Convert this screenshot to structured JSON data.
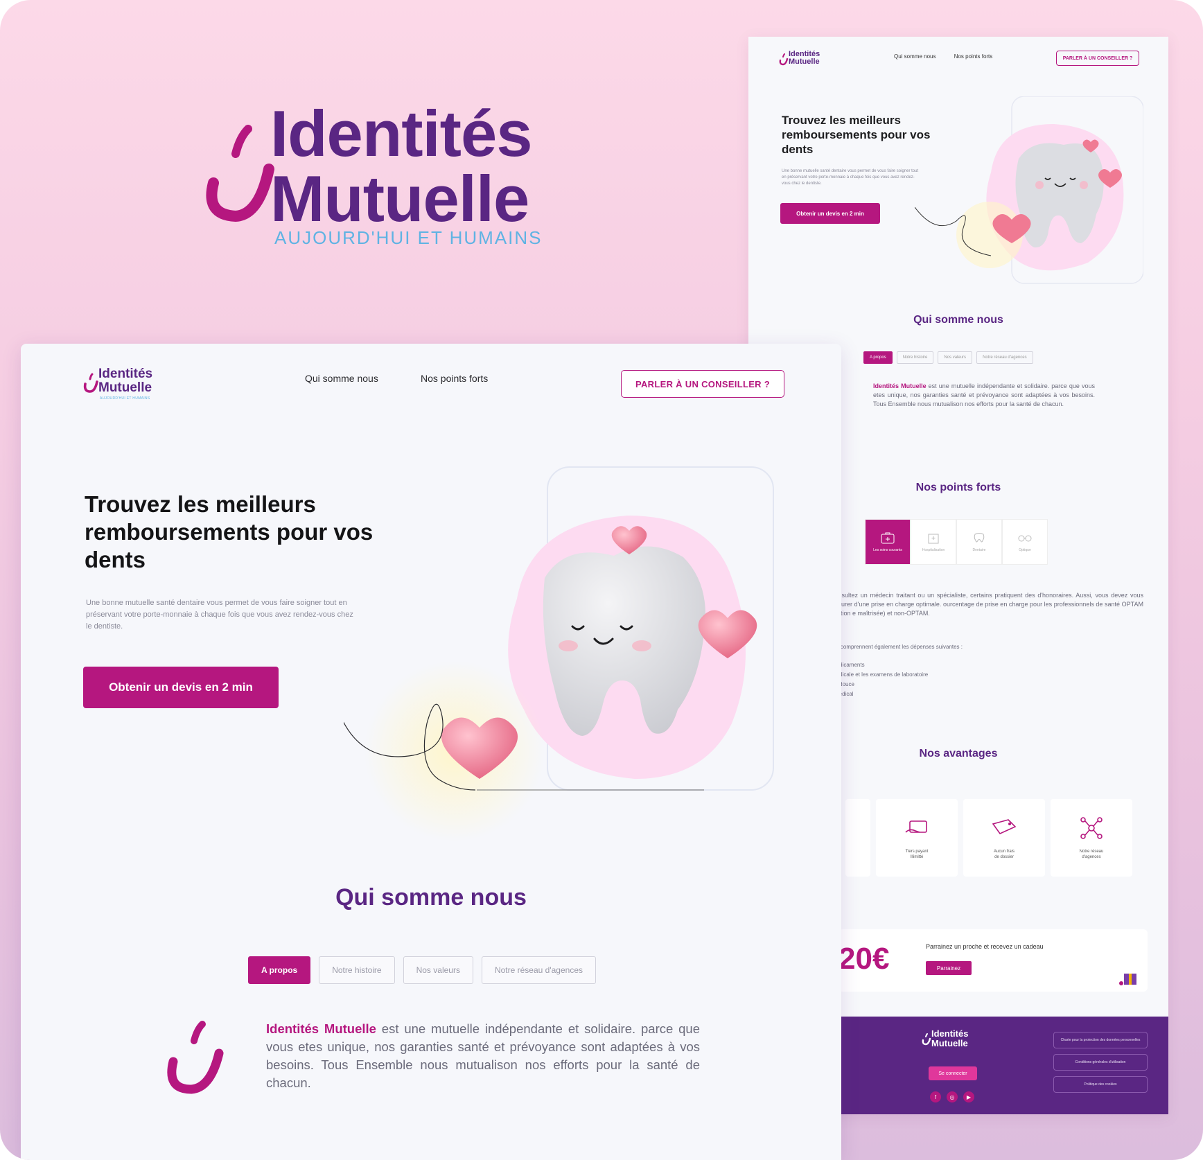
{
  "brand": {
    "name_line1": "Identités",
    "name_line2": "Mutuelle",
    "tagline": "AUJOURD'HUI ET HUMAINS",
    "colors": {
      "primary": "#b5177f",
      "purple": "#5a2683",
      "accent_blue": "#5fb3e3"
    }
  },
  "front": {
    "nav": {
      "links": [
        "Qui somme nous",
        "Nos points forts"
      ],
      "cta": "PARLER À UN CONSEILLER ?"
    },
    "hero": {
      "title": "Trouvez les meilleurs remboursements pour vos dents",
      "text": "Une bonne mutuelle santé dentaire vous permet de vous faire soigner tout en préservant votre porte-monnaie à chaque fois que vous avez rendez-vous chez le dentiste.",
      "button": "Obtenir un devis en 2 min"
    },
    "about": {
      "title": "Qui somme nous",
      "tabs": [
        "A propos",
        "Notre histoire",
        "Nos valeurs",
        "Notre réseau d'agences"
      ],
      "active_tab": "A propos",
      "brand_inline": "Identités Mutuelle",
      "text": " est une mutuelle indépendante et solidaire. parce que  vous etes unique, nos garanties santé et prévoyance sont adaptées à vos besoins. Tous Ensemble nous mutualison nos efforts pour la santé de chacun."
    }
  },
  "back": {
    "nav": {
      "links": [
        "Qui somme nous",
        "Nos points forts"
      ],
      "cta": "PARLER À UN CONSEILLER ?"
    },
    "hero": {
      "title": "Trouvez les meilleurs remboursements pour vos dents",
      "text": "Une bonne mutuelle santé dentaire vous permet de vous faire soigner tout en préservant votre porte-monnaie à chaque fois que vous avez rendez-vous chez le dentiste.",
      "button": "Obtenir un devis en 2 min"
    },
    "about": {
      "title": "Qui somme nous",
      "tabs": [
        "A propos",
        "Notre histoire",
        "Nos valeurs",
        "Notre réseau d'agences"
      ],
      "brand_inline": "Identités Mutuelle",
      "text": " est une mutuelle indépendante et solidaire. parce que  vous etes unique, nos garanties santé et prévoyance sont adaptées à vos besoins. Tous Ensemble nous mutualison nos efforts pour la santé de chacun."
    },
    "points": {
      "title": "Nos points forts",
      "items": [
        "Les soins courants",
        "Hospitalisation",
        "Dentaire",
        "Optique"
      ],
      "text": "consultez un médecin traitant ou un spécialiste, certains pratiquent des d'honoraires. Aussi, vous devez vous assurer d'une prise en charge optimale. ourcentage de prise en charge pour les professionnels de santé OPTAM (option e maîtrisée) et non-OPTAM.",
      "subtitle": "nts comprennent également les dépenses suivantes :",
      "list": [
        "médicaments",
        "médicale et les examens de laboratoire",
        "ne douce",
        "l médical"
      ]
    },
    "advantages": {
      "title": "Nos avantages",
      "items": [
        {
          "label_1": "Tiers payant",
          "label_2": "Illimitté",
          "icon": "card-hand-icon"
        },
        {
          "label_1": "Aucun frais",
          "label_2": "de dossier",
          "icon": "free-tag-icon"
        },
        {
          "label_1": "Notre réseau",
          "label_2": "d'agences",
          "icon": "network-icon"
        }
      ]
    },
    "promo": {
      "amount": "20€",
      "text": "Parrainez un proche et recevez un cadeau",
      "button": "Parrainez"
    },
    "footer": {
      "login": "Se connecter",
      "links": [
        "Charte pour la protection des données personnelles",
        "Conditions générales d'utilisation",
        "Politique des cookies"
      ]
    }
  }
}
